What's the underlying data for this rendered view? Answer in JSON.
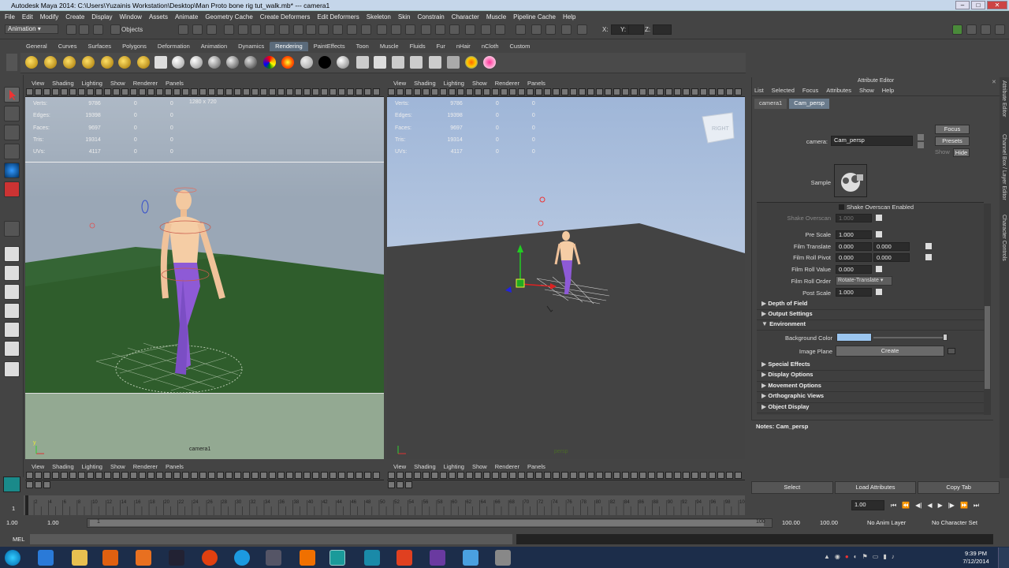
{
  "window": {
    "title": "Autodesk Maya 2014: C:\\Users\\Yuzainis Workstation\\Desktop\\Man Proto bone rig tut_walk.mb*   ---   camera1"
  },
  "menubar": [
    "File",
    "Edit",
    "Modify",
    "Create",
    "Display",
    "Window",
    "Assets",
    "Animate",
    "Geometry Cache",
    "Create Deformers",
    "Edit Deformers",
    "Skeleton",
    "Skin",
    "Constrain",
    "Character",
    "Muscle",
    "Pipeline Cache",
    "Help"
  ],
  "toolbar": {
    "mode": "Animation",
    "objects_label": "Objects",
    "x_label": "X:",
    "y_label": "Y:",
    "z_label": "Z:"
  },
  "shelf_tabs": [
    "General",
    "Curves",
    "Surfaces",
    "Polygons",
    "Deformation",
    "Animation",
    "Dynamics",
    "Rendering",
    "PaintEffects",
    "Toon",
    "Muscle",
    "Fluids",
    "Fur",
    "nHair",
    "nCloth",
    "Custom"
  ],
  "shelf_active": "Rendering",
  "viewport_menu": [
    "View",
    "Shading",
    "Lighting",
    "Show",
    "Renderer",
    "Panels"
  ],
  "hud": {
    "rows": [
      [
        "Verts:",
        "9786",
        "0",
        "0"
      ],
      [
        "Edges:",
        "19398",
        "0",
        "0"
      ],
      [
        "Faces:",
        "9697",
        "0",
        "0"
      ],
      [
        "Tris:",
        "19314",
        "0",
        "0"
      ],
      [
        "UVs:",
        "4117",
        "0",
        "0"
      ]
    ],
    "resolution": "1280 x 720"
  },
  "left_viewport": {
    "camera_label": "camera1"
  },
  "right_viewport": {
    "camera_label": "persp",
    "cube_label": "RIGHT"
  },
  "attr_editor": {
    "title": "Attribute Editor",
    "menu": [
      "List",
      "Selected",
      "Focus",
      "Attributes",
      "Show",
      "Help"
    ],
    "tabs": [
      "camera1",
      "Cam_persp"
    ],
    "active_tab": "Cam_persp",
    "camera_label": "camera:",
    "camera_value": "Cam_persp",
    "focus_btn": "Focus",
    "presets_btn": "Presets",
    "show_btn": "Show",
    "hide_btn": "Hide",
    "sample_label": "Sample",
    "shake_overscan_enabled": "Shake Overscan Enabled",
    "shake_overscan_label": "Shake Overscan",
    "shake_overscan_value": "1.000",
    "pre_scale_label": "Pre Scale",
    "pre_scale": "1.000",
    "film_translate_label": "Film Translate",
    "film_translate": [
      "0.000",
      "0.000"
    ],
    "film_roll_pivot_label": "Film Roll Pivot",
    "film_roll_pivot": [
      "0.000",
      "0.000"
    ],
    "film_roll_value_label": "Film Roll Value",
    "film_roll_value": "0.000",
    "film_roll_order_label": "Film Roll Order",
    "film_roll_order": "Rotate-Translate",
    "post_scale_label": "Post Scale",
    "post_scale": "1.000",
    "sections_top": [
      "Depth of Field",
      "Output Settings"
    ],
    "environment": "Environment",
    "bg_color_label": "Background Color",
    "image_plane_label": "Image Plane",
    "create_btn": "Create",
    "sections_bottom": [
      "Special Effects",
      "Display Options",
      "Movement Options",
      "Orthographic Views",
      "Object Display"
    ],
    "notes": "Notes: Cam_persp",
    "bottom_buttons": [
      "Select",
      "Load Attributes",
      "Copy Tab"
    ],
    "side_tabs": [
      "Attribute Editor",
      "Channel Box / Layer Editor",
      "Character Controls"
    ]
  },
  "timeline": {
    "ticks": [
      "1",
      "2",
      "4",
      "6",
      "8",
      "10",
      "12",
      "14",
      "16",
      "18",
      "20",
      "22",
      "24",
      "26",
      "28",
      "30",
      "32",
      "34",
      "36",
      "38",
      "40",
      "42",
      "44",
      "46",
      "48",
      "50",
      "52",
      "54",
      "56",
      "58",
      "60",
      "62",
      "64",
      "66",
      "68",
      "70",
      "72",
      "74",
      "76",
      "78",
      "80",
      "82",
      "84",
      "86",
      "88",
      "90",
      "92",
      "94",
      "96",
      "98",
      "100"
    ],
    "current": "1.00"
  },
  "range": {
    "start": "1.00",
    "start2": "1.00",
    "marker": "1",
    "end_marker": "100",
    "end": "100.00",
    "end2": "100.00",
    "anim_layer": "No Anim Layer",
    "char_set": "No Character Set"
  },
  "cmd": {
    "label": "MEL"
  },
  "clock": {
    "time": "9:39 PM",
    "date": "7/12/2014"
  }
}
